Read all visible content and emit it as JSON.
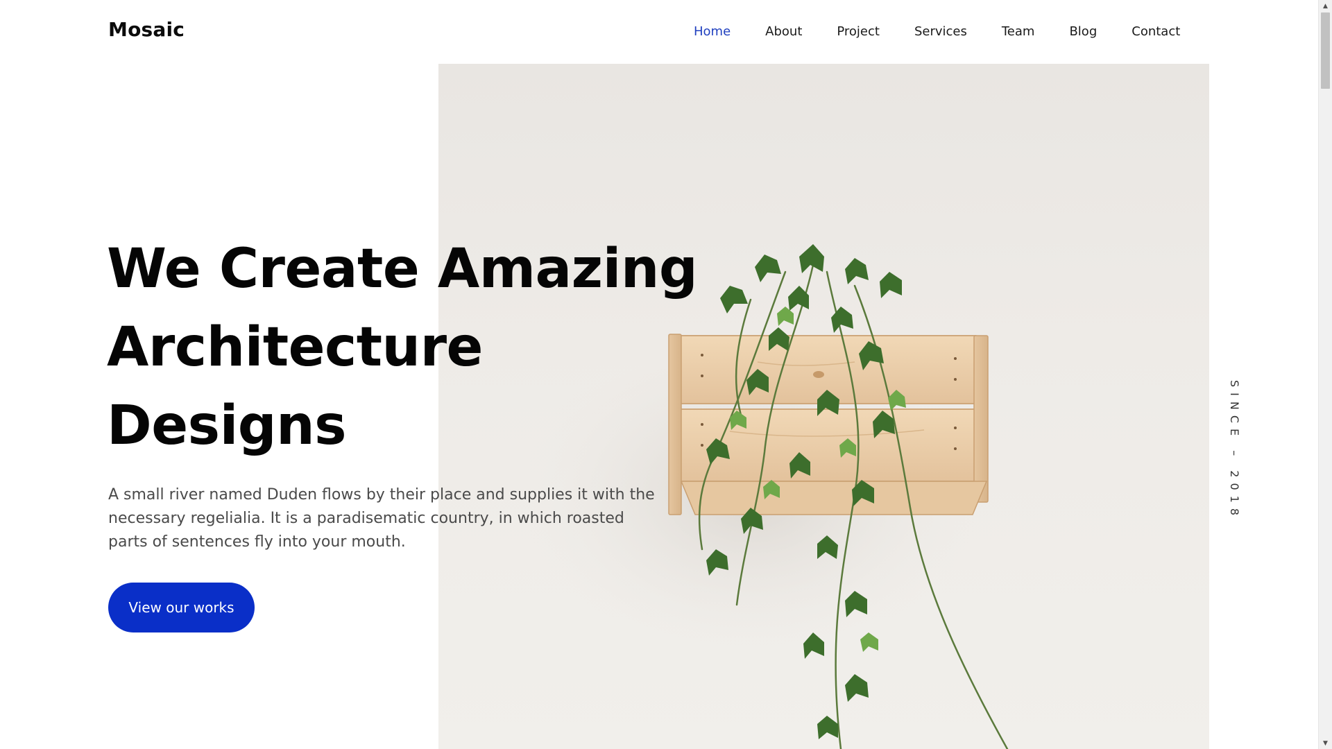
{
  "brand": {
    "name": "Mosaic"
  },
  "nav": {
    "items": [
      {
        "label": "Home",
        "active": true
      },
      {
        "label": "About",
        "active": false
      },
      {
        "label": "Project",
        "active": false
      },
      {
        "label": "Services",
        "active": false
      },
      {
        "label": "Team",
        "active": false
      },
      {
        "label": "Blog",
        "active": false
      },
      {
        "label": "Contact",
        "active": false
      }
    ]
  },
  "hero": {
    "headline_lines": [
      "We Create Amazing",
      "Architecture",
      "Designs"
    ],
    "description": "A small river named Duden flows by their place and supplies it with the necessary regelialia. It is a paradisematic country, in which roasted parts of sentences fly into your mouth.",
    "cta_label": "View our works",
    "since_label": "SINCE – 2018",
    "image_icon": "plant-in-wooden-crate-image"
  },
  "scrollbar": {
    "up_icon": "scroll-up-arrow-icon",
    "down_icon": "scroll-down-arrow-icon"
  },
  "colors": {
    "accent": "#0a2fc8",
    "nav_active": "#1f3fbf",
    "text_dark": "#050505",
    "text_body": "#4a4a4a",
    "image_background": "#ece9e5",
    "wood": "#e8c9a3",
    "leaf": "#3f7a2f"
  }
}
